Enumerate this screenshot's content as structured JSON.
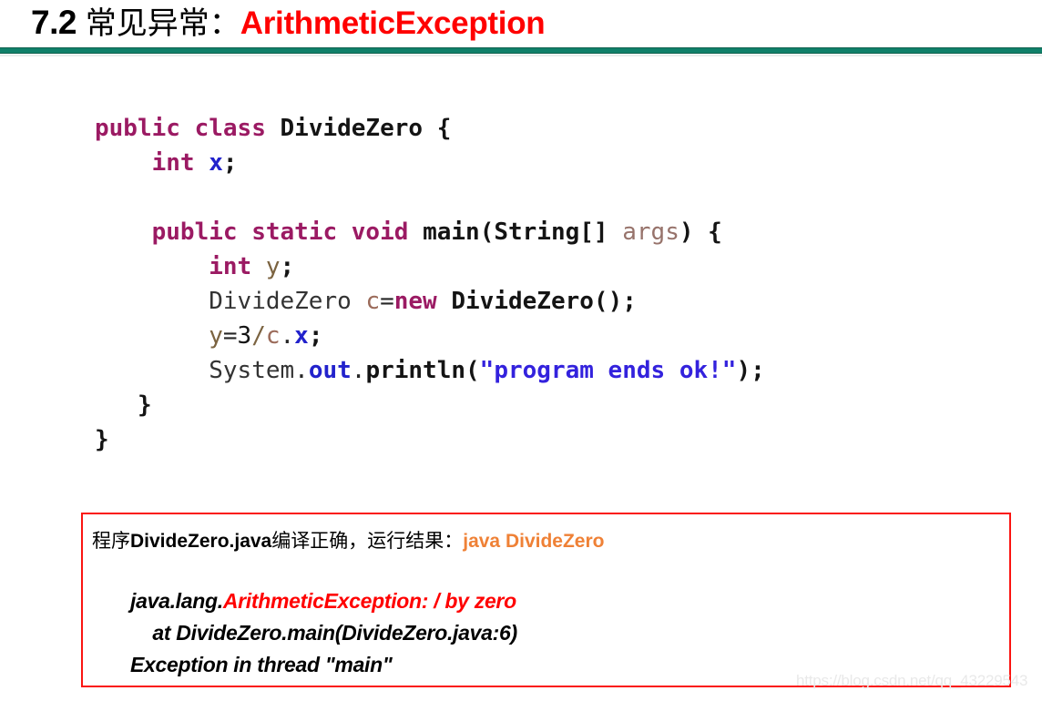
{
  "slide": {
    "title": {
      "number": "7.2",
      "chinese": "常见异常：",
      "highlight": "ArithmeticException"
    },
    "divider_color": "#0f8069"
  },
  "code": {
    "language": "java",
    "lines": [
      {
        "id": "line-class-decl",
        "text": "public class DivideZero {",
        "tokens": [
          {
            "t": "public",
            "c": "kw"
          },
          {
            "t": " ",
            "c": "plain"
          },
          {
            "t": "class",
            "c": "kw"
          },
          {
            "t": " ",
            "c": "plain"
          },
          {
            "t": "DivideZero",
            "c": "cls"
          },
          {
            "t": " ",
            "c": "plain"
          },
          {
            "t": "{",
            "c": "punct"
          }
        ]
      },
      {
        "id": "line-field-x",
        "text": "    int x;",
        "tokens": [
          {
            "t": "    ",
            "c": "plain"
          },
          {
            "t": "int",
            "c": "kw"
          },
          {
            "t": " ",
            "c": "plain"
          },
          {
            "t": "x",
            "c": "varblue"
          },
          {
            "t": ";",
            "c": "punct"
          }
        ]
      },
      {
        "id": "line-blank-1",
        "text": "",
        "tokens": []
      },
      {
        "id": "line-main-sig",
        "text": "    public static void main(String[] args) {",
        "tokens": [
          {
            "t": "    ",
            "c": "plain"
          },
          {
            "t": "public",
            "c": "kw"
          },
          {
            "t": " ",
            "c": "plain"
          },
          {
            "t": "static",
            "c": "kw"
          },
          {
            "t": " ",
            "c": "plain"
          },
          {
            "t": "void",
            "c": "kw"
          },
          {
            "t": " ",
            "c": "plain"
          },
          {
            "t": "main",
            "c": "cls"
          },
          {
            "t": "(",
            "c": "punct"
          },
          {
            "t": "String",
            "c": "cls"
          },
          {
            "t": "[]",
            "c": "punct"
          },
          {
            "t": " ",
            "c": "plain"
          },
          {
            "t": "args",
            "c": "args"
          },
          {
            "t": ")",
            "c": "punct"
          },
          {
            "t": " ",
            "c": "plain"
          },
          {
            "t": "{",
            "c": "punct"
          }
        ]
      },
      {
        "id": "line-local-y",
        "text": "        int y;",
        "tokens": [
          {
            "t": "        ",
            "c": "plain"
          },
          {
            "t": "int",
            "c": "kw"
          },
          {
            "t": " ",
            "c": "plain"
          },
          {
            "t": "y",
            "c": "varolive"
          },
          {
            "t": ";",
            "c": "punct"
          }
        ]
      },
      {
        "id": "line-new-instance",
        "text": "        DivideZero c=new DivideZero();",
        "tokens": [
          {
            "t": "        ",
            "c": "plain"
          },
          {
            "t": "DivideZero",
            "c": "clsplain"
          },
          {
            "t": " ",
            "c": "plain"
          },
          {
            "t": "c",
            "c": "varbrn"
          },
          {
            "t": "=",
            "c": "plain"
          },
          {
            "t": "new",
            "c": "kw"
          },
          {
            "t": " ",
            "c": "plain"
          },
          {
            "t": "DivideZero",
            "c": "cls"
          },
          {
            "t": "();",
            "c": "punct"
          }
        ]
      },
      {
        "id": "line-divide",
        "text": "        y=3/c.x;",
        "tokens": [
          {
            "t": "        ",
            "c": "plain"
          },
          {
            "t": "y",
            "c": "varolive"
          },
          {
            "t": "=",
            "c": "plain"
          },
          {
            "t": "3",
            "c": "num"
          },
          {
            "t": "/",
            "c": "varolive"
          },
          {
            "t": "c",
            "c": "varbrn"
          },
          {
            "t": ".",
            "c": "plain"
          },
          {
            "t": "x",
            "c": "varblue"
          },
          {
            "t": ";",
            "c": "punct"
          }
        ]
      },
      {
        "id": "line-println",
        "text": "        System.out.println(\"program ends ok!\");",
        "tokens": [
          {
            "t": "        ",
            "c": "plain"
          },
          {
            "t": "System",
            "c": "clsplain"
          },
          {
            "t": ".",
            "c": "plain"
          },
          {
            "t": "out",
            "c": "varblue"
          },
          {
            "t": ".",
            "c": "plain"
          },
          {
            "t": "println",
            "c": "cls"
          },
          {
            "t": "(",
            "c": "punct"
          },
          {
            "t": "\"program ends ok!\"",
            "c": "str"
          },
          {
            "t": ");",
            "c": "punct"
          }
        ]
      },
      {
        "id": "line-close-main",
        "text": "   }",
        "tokens": [
          {
            "t": "   ",
            "c": "plain"
          },
          {
            "t": "}",
            "c": "punct"
          }
        ]
      },
      {
        "id": "line-close-class",
        "text": "}",
        "tokens": [
          {
            "t": "}",
            "c": "punct"
          }
        ]
      }
    ]
  },
  "output_box": {
    "border_color": "#fb1511",
    "description_line": {
      "prefix_cn": "程序",
      "filename": "DivideZero.java",
      "middle_cn": "编译正确，运行结果：",
      "command": "java DivideZero"
    },
    "trace_lines": [
      {
        "id": "trace-exception",
        "segments": [
          {
            "t": "java.lang.",
            "c": "trace-blk"
          },
          {
            "t": "ArithmeticException: / by zero",
            "c": "trace-red"
          }
        ]
      },
      {
        "id": "trace-at",
        "segments": [
          {
            "t": "    at DivideZero.main(DivideZero.java:6)",
            "c": "trace-blk"
          }
        ]
      },
      {
        "id": "trace-thread",
        "segments": [
          {
            "t": "Exception in thread \"main\"",
            "c": "trace-blk"
          }
        ]
      }
    ]
  },
  "watermark": {
    "text": "https://blog.csdn.net/qq_43229543"
  }
}
